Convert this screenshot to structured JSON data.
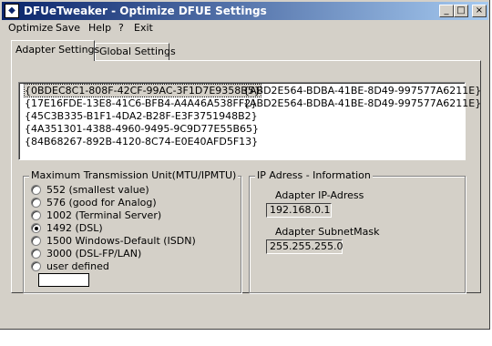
{
  "window": {
    "title": "DFUeTweaker - Optimize DFUE Settings",
    "controls": {
      "minimize": "_",
      "maximize": "□",
      "close": "×"
    }
  },
  "menu": [
    "Optimize",
    "Save",
    "Help",
    "?",
    "Exit"
  ],
  "tabs": [
    {
      "label": "Adapter Settings",
      "active": true
    },
    {
      "label": "Global Settings",
      "active": false
    }
  ],
  "adapters": {
    "left": [
      "{0BDEC8C1-808F-42CF-99AC-3F1D7E9358B5}",
      "{17E16FDE-13E8-41C6-BFB4-A4A46A538FF2}",
      "{45C3B335-B1F1-4DA2-B28F-E3F3751948B2}",
      "{4A351301-4388-4960-9495-9C9D77E55B65}",
      "{84B68267-892B-4120-8C74-E0E40AFD5F13}"
    ],
    "right": [
      "{ABD2E564-BDBA-41BE-8D49-997577A6211E}",
      "{ABD2E564-BDBA-41BE-8D49-997577A6211E}"
    ],
    "selected_index": 0
  },
  "mtu": {
    "group_label": "Maximum Transmission Unit(MTU/IPMTU)",
    "options": [
      {
        "label": "552 (smallest value)",
        "checked": false
      },
      {
        "label": "576 (good for  Analog)",
        "checked": false
      },
      {
        "label": "1002 (Terminal Server)",
        "checked": false
      },
      {
        "label": "1492 (DSL)",
        "checked": true
      },
      {
        "label": "1500 Windows-Default (ISDN)",
        "checked": false
      },
      {
        "label": "3000 (DSL-FP/LAN)",
        "checked": false
      },
      {
        "label": "user defined",
        "checked": false
      }
    ],
    "user_value": ""
  },
  "ip": {
    "group_label": "IP Adress - Information",
    "address_label": "Adapter IP-Adress",
    "address_value": "192.168.0.1",
    "mask_label": "Adapter SubnetMask",
    "mask_value": "255.255.255.0"
  },
  "colors": {
    "titlebar_start": "#0a246a",
    "titlebar_end": "#a6caf0",
    "face": "#d4d0c8"
  }
}
